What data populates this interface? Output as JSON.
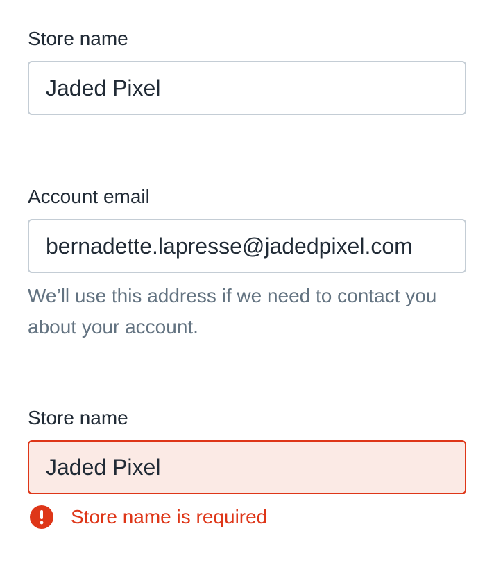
{
  "fields": [
    {
      "label": "Store name",
      "value": "Jaded Pixel"
    },
    {
      "label": "Account email",
      "value": "bernadette.lapresse@jadedpixel.com",
      "help_text": "We’ll use this address if we need to contact you about your account."
    },
    {
      "label": "Store name",
      "value": "Jaded Pixel",
      "error": "Store name is required"
    }
  ],
  "colors": {
    "text": "#212b36",
    "border": "#c4cdd5",
    "subdued": "#637381",
    "error": "#de3618",
    "error_background": "#fbeae5"
  },
  "icons": {
    "error": "alert-circle-icon"
  }
}
